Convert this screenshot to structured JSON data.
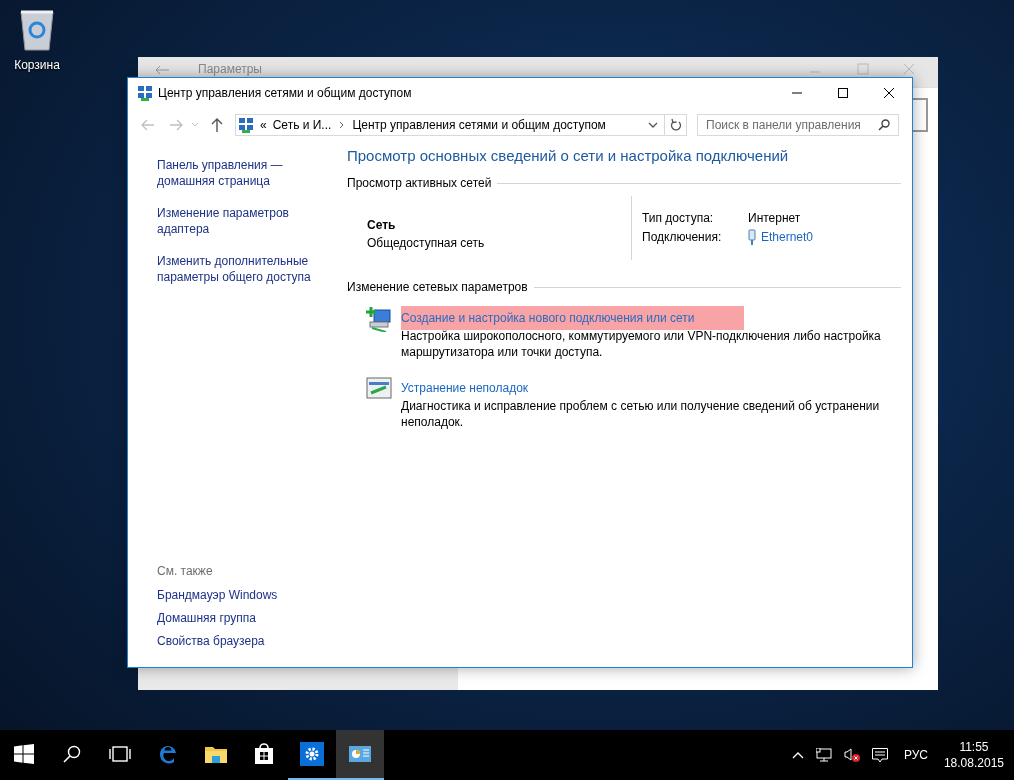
{
  "desktop": {
    "icons": [
      {
        "label": "Корзина"
      }
    ]
  },
  "background_window": {
    "title": "Параметры"
  },
  "window": {
    "title": "Центр управления сетями и общим доступом"
  },
  "address_bar": {
    "overflow": "«",
    "crumbs": [
      "Сеть и И...",
      "Центр управления сетями и общим доступом"
    ]
  },
  "search": {
    "placeholder": "Поиск в панели управления"
  },
  "sidebar": {
    "links": [
      "Панель управления — домашняя страница",
      "Изменение параметров адаптера",
      "Изменить дополнительные параметры общего доступа"
    ],
    "see_also": {
      "heading": "См. также",
      "links": [
        "Брандмауэр Windows",
        "Домашняя группа",
        "Свойства браузера"
      ]
    }
  },
  "main": {
    "heading": "Просмотр основных сведений о сети и настройка подключений",
    "active_networks": {
      "heading": "Просмотр активных сетей",
      "network": {
        "name": "Сеть",
        "type": "Общедоступная сеть"
      },
      "properties": [
        {
          "label": "Тип доступа:",
          "value": "Интернет",
          "kind": "text"
        },
        {
          "label": "Подключения:",
          "value": "Ethernet0",
          "kind": "link"
        }
      ]
    },
    "change_settings": {
      "heading": "Изменение сетевых параметров",
      "tasks": [
        {
          "kind": "new-connection",
          "title": "Создание и настройка нового подключения или сети",
          "description": "Настройка широкополосного, коммутируемого или VPN-подключения либо настройка маршрутизатора или точки доступа.",
          "highlighted": true
        },
        {
          "kind": "troubleshoot",
          "title": "Устранение неполадок",
          "description": "Диагностика и исправление проблем с сетью или получение сведений об устранении неполадок.",
          "highlighted": false
        }
      ]
    }
  },
  "taskbar": {
    "apps": [
      {
        "kind": "start",
        "open": false,
        "selected": false
      },
      {
        "kind": "search",
        "open": false,
        "selected": false
      },
      {
        "kind": "task-view",
        "open": false,
        "selected": false
      },
      {
        "kind": "edge",
        "open": false,
        "selected": false
      },
      {
        "kind": "explorer",
        "open": false,
        "selected": false
      },
      {
        "kind": "store",
        "open": false,
        "selected": false
      },
      {
        "kind": "settings",
        "open": true,
        "selected": false
      },
      {
        "kind": "control-panel",
        "open": true,
        "selected": true
      }
    ],
    "language": "РУС",
    "time": "11:55",
    "date": "18.08.2015"
  }
}
